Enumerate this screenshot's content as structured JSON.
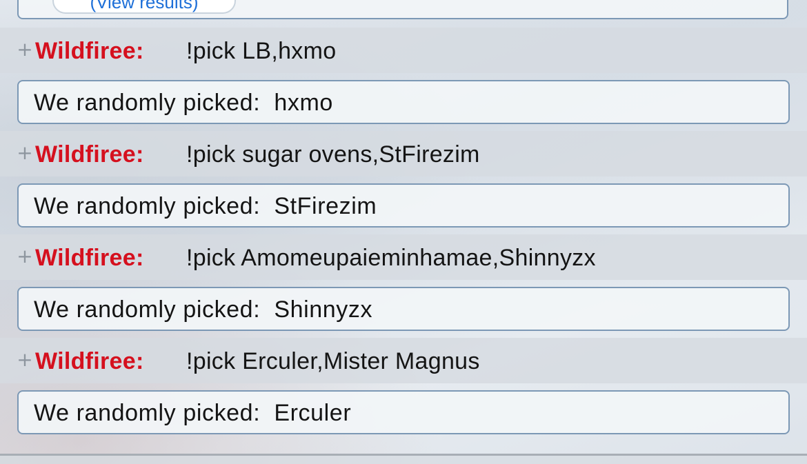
{
  "poll": {
    "view_results_label": "(View results)"
  },
  "messages": [
    {
      "user": "Wildfiree:",
      "text": "!pick LB,hxmo",
      "result_prefix": "We randomly picked:",
      "result_value": "hxmo"
    },
    {
      "user": "Wildfiree:",
      "text": "!pick sugar ovens,StFirezim",
      "result_prefix": "We randomly picked:",
      "result_value": "StFirezim"
    },
    {
      "user": "Wildfiree:",
      "text": "!pick Amomeupaieminhamae,Shinnyzx",
      "result_prefix": "We randomly picked:",
      "result_value": "Shinnyzx"
    },
    {
      "user": "Wildfiree:",
      "text": "!pick Erculer,Mister Magnus",
      "result_prefix": "We randomly picked:",
      "result_value": "Erculer"
    }
  ],
  "icons": {
    "expand": "plus-icon"
  },
  "colors": {
    "username": "#d5101e",
    "link": "#1d6fd8",
    "box_border": "#7c98b5"
  }
}
